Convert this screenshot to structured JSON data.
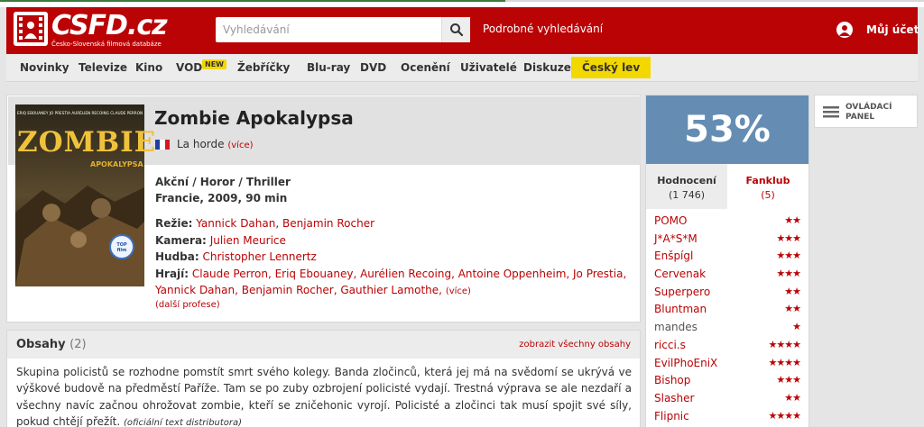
{
  "header": {
    "logo_text": "CSFD.cz",
    "logo_sub": "Česko-Slovenská filmová databáze",
    "search_placeholder": "Vyhledávání",
    "advanced_search": "Podrobné vyhledávání",
    "account": "Můj účet"
  },
  "nav": {
    "items": [
      "Novinky",
      "Televize",
      "Kino",
      "VOD",
      "Žebříčky",
      "Blu-ray",
      "DVD",
      "Ocenění",
      "Uživatelé",
      "Diskuze",
      "Český lev"
    ],
    "vod_badge": "NEW"
  },
  "film": {
    "title": "Zombie Apokalypsa",
    "alt_title": "La horde",
    "alt_more": "(více)",
    "genre": "Akční / Horor / Thriller",
    "origin": "Francie, 2009, 90 min",
    "directing_label": "Režie:",
    "directors": [
      "Yannick Dahan",
      "Benjamin Rocher"
    ],
    "camera_label": "Kamera:",
    "camera": "Julien Meurice",
    "music_label": "Hudba:",
    "music": "Christopher Lennertz",
    "cast_label": "Hrají:",
    "cast_line1": "Claude Perron, Eriq Ebouaney, Aurélien Recoing, Antoine Oppenheim, Jo Prestia,",
    "cast_line2": "Yannick Dahan, Benjamin Rocher, Gauthier Lamothe,",
    "cast_more": "(více)",
    "more_professions": "(další profese)",
    "poster": {
      "top_names": "ERIQ EBOUANEY  JO PRESTIA  AURÉLIEN RECOING  CLAUDE PERRON",
      "big_title": "ZOMBIE",
      "sub_title": "APOKALYPSA",
      "badge": "TOP film"
    }
  },
  "plot": {
    "heading": "Obsahy",
    "count": "(2)",
    "show_all": "zobrazit všechny obsahy",
    "text": "Skupina policistů se rozhodne pomstít smrt svého kolegy. Banda zločinců, která jej má na svědomí se ukrývá ve výškové budově na předměstí Paříže. Tam se po zuby ozbrojení policisté vydají. Trestná výprava se ale nezdaří a všechny navíc začnou ohrožovat zombie, kteří se zničehonic vyrojí. Policisté a zločinci tak musí spojit své síly, pokud chtějí přežít.",
    "source": "(oficiální text distributora)"
  },
  "rating": {
    "percent": "53%",
    "tab_ratings_label": "Hodnocení",
    "tab_ratings_count": "(1 746)",
    "tab_fanclub_label": "Fanklub",
    "tab_fanclub_count": "(5)",
    "users": [
      {
        "name": "POMO",
        "stars": 2
      },
      {
        "name": "J*A*S*M",
        "stars": 3
      },
      {
        "name": "Enšpígl",
        "stars": 3
      },
      {
        "name": "Cervenak",
        "stars": 3
      },
      {
        "name": "Superpero",
        "stars": 2
      },
      {
        "name": "Bluntman",
        "stars": 2
      },
      {
        "name": "mandes",
        "stars": 1
      },
      {
        "name": "ricci.s",
        "stars": 4
      },
      {
        "name": "EvilPhoEniX",
        "stars": 4
      },
      {
        "name": "Bishop",
        "stars": 3
      },
      {
        "name": "Slasher",
        "stars": 2
      },
      {
        "name": "Flipnic",
        "stars": 4
      }
    ],
    "star_color": "#ba0305"
  },
  "panel_button": "OVLÁDACÍ PANEL",
  "colors": {
    "brand_red": "#ba0305",
    "rating_blue": "#658db4",
    "lev_yellow": "#f3d800"
  }
}
